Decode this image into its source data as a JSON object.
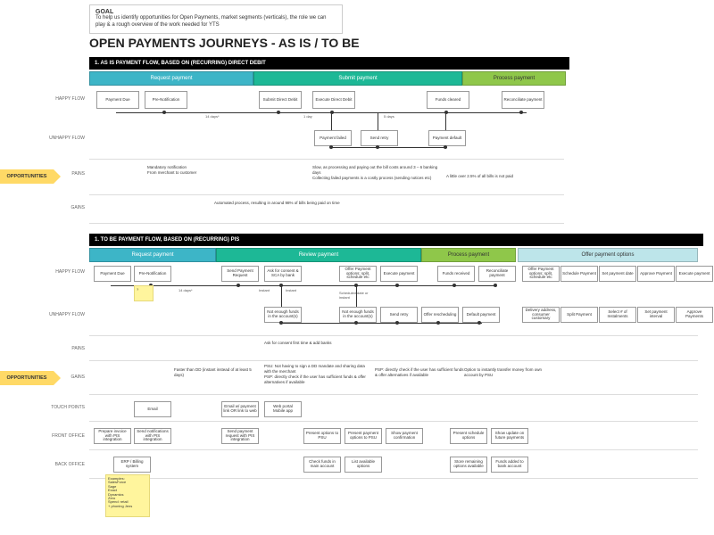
{
  "goal": {
    "title": "GOAL",
    "text": "To help us identify opportunities for Open Payments, market segments (verticals), the role we can play & a rough overview of the work needed for YTS"
  },
  "page_title": "OPEN PAYMENTS JOURNEYS - AS IS / TO BE",
  "section1": {
    "title": "1. AS IS PAYMENT FLOW, BASED ON (RECURRING) DIRECT DEBIT",
    "phases": {
      "p1": "Request payment",
      "p2": "Submit payment",
      "p3": "Process payment"
    },
    "rows": {
      "happy": "HAPPY FLOW",
      "unhappy": "UNHAPPY FLOW",
      "pains": "PAINS",
      "gains": "GAINS"
    },
    "nodes": {
      "payment_due": "Payment Due",
      "pre_notif": "Pre-Notification",
      "submit_dd": "Submit Direct Debit",
      "execute_dd": "Execute Direct Debit",
      "funds_cleared": "Funds cleared",
      "reconciliate": "Reconciliate payment",
      "payment_failed": "Payment failed",
      "send_retry": "Send retry",
      "payment_default": "Payment default"
    },
    "timings": {
      "t1": "14 days*",
      "t2": "1 day",
      "t3": "5 days"
    },
    "pains": {
      "p1": "Mandatory notification\nFrom merchant to customer",
      "p2": "Slow, as processing and paying out the bill costs around 3 – 6 banking days\nCollecting failed payments is a costly process (sending notices etc)",
      "p3": "A little over 2.5% of all bills is not paid"
    },
    "gains": {
      "g1": "Automated process, resulting in around 98% of bills being paid on time"
    }
  },
  "section2": {
    "title": "1. TO BE PAYMENT FLOW, BASED ON (RECURRING) PIS",
    "phases": {
      "p1": "Request payment",
      "p2": "Review payment",
      "p3": "Process payment",
      "p4": "Offer payment options"
    },
    "rows": {
      "happy": "HAPPY FLOW",
      "unhappy": "UNHAPPY FLOW",
      "pains": "PAINS",
      "gains": "GAINS",
      "touch": "TOUCH POINTS",
      "front": "FRONT OFFICE",
      "back": "BACK OFFICE"
    },
    "nodes": {
      "payment_due": "Payment Due",
      "pre_notif": "Pre-Notification",
      "send_req": "Send Payment Request",
      "ask_consent": "Ask for consent & SCA by bank",
      "offer_options": "Offer Payment options: split, schedule etc",
      "execute": "Execute payment",
      "funds_received": "Funds received",
      "reconciliate": "Reconciliate payment",
      "not_enough1": "Not enough funds in the account(s)",
      "not_enough2": "Not enough funds in the account(s)",
      "send_retry": "Send retry",
      "offer_resched": "Offer rescheduling",
      "default": "Default payment",
      "opt1": "Offer Payment options: split, schedule etc",
      "opt2": "Schedule Payment",
      "opt3": "Set payment date",
      "opt4": "Approve Payment",
      "opt5": "Execute payment",
      "opt6": "Delivery address, consumer customary",
      "opt7": "Split Payment",
      "opt8": "Select # of Instalments",
      "opt9": "Set payment interval",
      "opt10": "Approve Payments"
    },
    "timings": {
      "t1": "14 days*",
      "t2": "Instant",
      "t3": "Instant",
      "sched": "Scheduled date or instant"
    },
    "pains": {
      "p1": "Ask for consent first time & add banks"
    },
    "gains": {
      "g1": "Faster than DD (instant instead of at least 5 days)",
      "g2": "PSU: Not having to sign a DD mandate and sharing data with the merchant\nPSP: directly check if the user has sufficient funds & offer alternatives if available",
      "g3": "PSP: directly check if the user has sufficient funds & offer alternatives if available",
      "g4": "Option to instantly transfer money from own account by PSU"
    },
    "touch": {
      "t1": "Email",
      "t2": "Email w/ payment link OR link to web",
      "t3": "Web portal\nMobile app"
    },
    "front": {
      "f1": "Prepare invoice with PIS integration",
      "f2": "Send notifications with PIS integration",
      "f3": "Send payment request with PIS integration",
      "f4": "Present options to PSU",
      "f5": "Present payment options to PSU",
      "f6": "Show payment confirmation",
      "f7": "Present schedule options",
      "f8": "Show update on future payments"
    },
    "back": {
      "b1": "ERP / Billing system",
      "b2": "Check funds in main account",
      "b3": "List available options",
      "b4": "Store remaining options available",
      "b5": "Funds added to bank account"
    },
    "sticky1": "?",
    "sticky2": "Examples:\nSalesForce\nSage\nExact\nDynamics\nZero\nSpend: retail\n+ phoning Jens"
  },
  "arrow_label": "OPPORTUNITIES"
}
